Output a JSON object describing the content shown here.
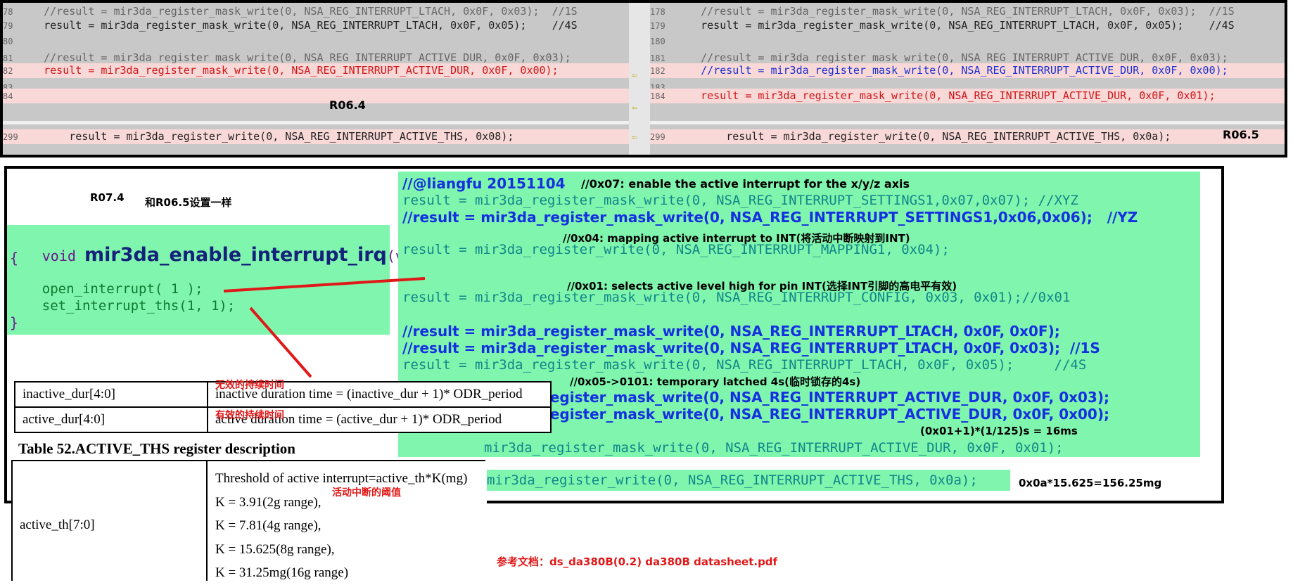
{
  "diff": {
    "left": {
      "lines": [
        {
          "no": "78",
          "text": "    //result = mir3da_register_mask_write(0, NSA_REG_INTERRUPT_LTACH, 0x0F, 0x03);  //1S",
          "cls": "comment",
          "hl": false
        },
        {
          "no": "79",
          "text": "    result = mir3da_register_mask_write(0, NSA_REG_INTERRUPT_LTACH, 0x0F, 0x05);    //4S",
          "cls": "",
          "hl": false
        },
        {
          "no": "80",
          "text": "",
          "cls": "",
          "hl": false
        },
        {
          "no": "81",
          "text": "    //result = mir3da_register_mask_write(0, NSA_REG_INTERRUPT_ACTIVE_DUR, 0x0F, 0x03);",
          "cls": "comment",
          "hl": false
        },
        {
          "no": "82",
          "text": "    result = mir3da_register_mask_write(0, NSA_REG_INTERRUPT_ACTIVE_DUR, 0x0F, 0x00);",
          "cls": "red",
          "hl": true
        },
        {
          "no": "83",
          "text": "",
          "cls": "",
          "hl": false
        },
        {
          "no": "84",
          "text": "",
          "cls": "",
          "hl": true
        }
      ],
      "label": "R06.4",
      "lower": "        result = mir3da_register_write(0, NSA_REG_INTERRUPT_ACTIVE_THS, 0x08);",
      "lower_no": "299"
    },
    "right": {
      "lines": [
        {
          "no": "178",
          "text": "    //result = mir3da_register_mask_write(0, NSA_REG_INTERRUPT_LTACH, 0x0F, 0x03);  //1S",
          "cls": "comment",
          "hl": false
        },
        {
          "no": "179",
          "text": "    result = mir3da_register_mask_write(0, NSA_REG_INTERRUPT_LTACH, 0x0F, 0x05);    //4S",
          "cls": "",
          "hl": false
        },
        {
          "no": "180",
          "text": "",
          "cls": "",
          "hl": false
        },
        {
          "no": "181",
          "text": "    //result = mir3da_register_mask_write(0, NSA_REG_INTERRUPT_ACTIVE_DUR, 0x0F, 0x03);",
          "cls": "comment",
          "hl": false
        },
        {
          "no": "182",
          "text": "    //result = mir3da_register_mask_write(0, NSA_REG_INTERRUPT_ACTIVE_DUR, 0x0F, 0x00);",
          "cls": "blue",
          "hl": true
        },
        {
          "no": "183",
          "text": "",
          "cls": "",
          "hl": false
        },
        {
          "no": "184",
          "text": "    result = mir3da_register_mask_write(0, NSA_REG_INTERRUPT_ACTIVE_DUR, 0x0F, 0x01);",
          "cls": "red",
          "hl": true
        }
      ],
      "label": "R06.5",
      "lower": "        result = mir3da_register_write(0, NSA_REG_INTERRUPT_ACTIVE_THS, 0x0a);",
      "lower_no": "299"
    }
  },
  "labels": {
    "r074": "R07.4",
    "same_as": "和R06.5设置一样",
    "author": "//@liangfu 20151104",
    "note_0x07": "//0x07: enable the active interrupt for the x/y/z axis",
    "note_0x04": "//0x04: mapping active interrupt to INT(将活动中断映射到INT)",
    "note_0x01": "//0x01: selects active level high for pin INT(选择INT引脚的高电平有效)",
    "note_0x05": "//0x05->0101: temporary latched 4s(临时锁存的4s)",
    "calc_dur": "(0x01+1)*(1/125)s = 16ms",
    "calc_ths": "0x0a*15.625=156.25mg",
    "ref_doc": "参考文档：ds_da380B(0.2) da380B datasheet.pdf",
    "inactive_cn": "无效的持续时间",
    "active_cn": "有效的持续时间",
    "threshold_cn": "活动中断的阈值"
  },
  "func": {
    "sig_void": "void ",
    "sig_name": "mir3da_enable_interrupt_irq",
    "sig_arg": "(void)",
    "open_brace": "{",
    "line1": "    open_interrupt( 1 );",
    "line2": "    set_interrupt_ths(1, 1);",
    "close_brace": "}"
  },
  "code": {
    "settings1": "result = mir3da_register_mask_write(0, NSA_REG_INTERRUPT_SETTINGS1,0x07,0x07); //XYZ",
    "settings1_c": "//result = mir3da_register_mask_write(0, NSA_REG_INTERRUPT_SETTINGS1,0x06,0x06);   //YZ",
    "mapping": "result = mir3da_register_write(0, NSA_REG_INTERRUPT_MAPPING1, 0x04);",
    "config": "result = mir3da_register_mask_write(0, NSA_REG_INTERRUPT_CONFIG, 0x03, 0x01);//0x01",
    "ltach_c1": "//result = mir3da_register_mask_write(0, NSA_REG_INTERRUPT_LTACH, 0x0F, 0x0F);",
    "ltach_c2": "//result = mir3da_register_mask_write(0, NSA_REG_INTERRUPT_LTACH, 0x0F, 0x03);  //1S",
    "ltach": "result = mir3da_register_mask_write(0, NSA_REG_INTERRUPT_LTACH, 0x0F, 0x05);     //4S",
    "dur_c1": "register_mask_write(0, NSA_REG_INTERRUPT_ACTIVE_DUR, 0x0F, 0x03);",
    "dur_c2": "register_mask_write(0, NSA_REG_INTERRUPT_ACTIVE_DUR, 0x0F, 0x00);",
    "dur": "mir3da_register_mask_write(0, NSA_REG_INTERRUPT_ACTIVE_DUR, 0x0F, 0x01);",
    "ths": "mir3da_register_write(0, NSA_REG_INTERRUPT_ACTIVE_THS, 0x0a);"
  },
  "table1": {
    "rows": [
      {
        "field": "inactive_dur[4:0]",
        "desc": "inactive duration time = (inactive_dur + 1)* ODR_period"
      },
      {
        "field": "active_dur[4:0]",
        "desc": "active duration time = (active_dur + 1)* ODR_period"
      }
    ]
  },
  "table2": {
    "caption": "Table 52.ACTIVE_THS register description",
    "field": "active_th[7:0]",
    "desc": [
      "Threshold of active interrupt=active_th*K(mg)",
      "K = 3.91(2g range),",
      "K = 7.81(4g range),",
      "K = 15.625(8g range),",
      "K = 31.25mg(16g range)"
    ]
  },
  "colors": {
    "highlight_green": "#80f5ad",
    "annotation_red": "#e01818",
    "code_blue": "#1530e0"
  }
}
